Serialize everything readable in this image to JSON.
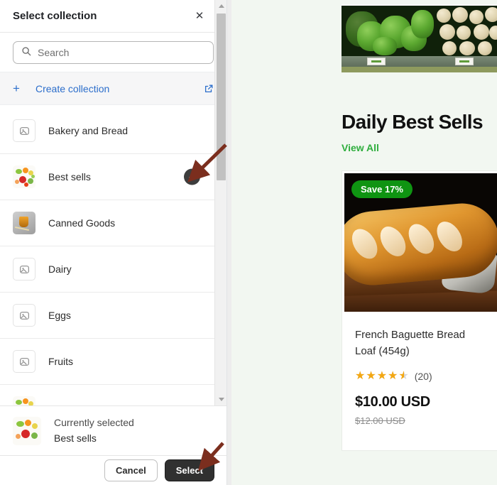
{
  "modal": {
    "title": "Select collection",
    "close_icon": "close-icon",
    "search": {
      "placeholder": "Search",
      "value": "",
      "icon": "search-icon"
    },
    "create": {
      "label": "Create collection",
      "plus_icon": "plus-icon",
      "external_icon": "external-link-icon"
    },
    "collections": [
      {
        "label": "Bakery and Bread",
        "thumb": "placeholder",
        "selected": false
      },
      {
        "label": "Best sells",
        "thumb": "vegetables",
        "selected": true
      },
      {
        "label": "Canned Goods",
        "thumb": "canned",
        "selected": false
      },
      {
        "label": "Dairy",
        "thumb": "placeholder",
        "selected": false
      },
      {
        "label": "Eggs",
        "thumb": "placeholder",
        "selected": false
      },
      {
        "label": "Fruits",
        "thumb": "placeholder",
        "selected": false
      },
      {
        "label": "",
        "thumb": "vegetables",
        "selected": false
      }
    ],
    "selected_summary": {
      "caption": "Currently selected",
      "name": "Best sells"
    },
    "footer": {
      "cancel_label": "Cancel",
      "select_label": "Select"
    },
    "scrollbar": {
      "up_icon": "chevron-up-icon",
      "down_icon": "chevron-down-icon"
    }
  },
  "storefront": {
    "hero_alt": "grocery-produce-shelf-photo",
    "section_title": "Daily Best Sells",
    "view_all_label": "View All",
    "product": {
      "badge": "Save 17%",
      "image_alt": "french-baguette-photo",
      "name": "French Baguette Bread Loaf (454g)",
      "rating": 4.5,
      "rating_stars": "★★★★★",
      "review_count": "(20)",
      "price": "$10.00 USD",
      "compare_at_price": "$12.00 USD"
    }
  },
  "colors": {
    "accent_blue": "#2c6ecb",
    "accent_green": "#2fae3e",
    "badge_green": "#0f9412",
    "primary_button": "#303030",
    "annotation": "#7b2e1e",
    "store_bg": "#f2f7f1"
  }
}
